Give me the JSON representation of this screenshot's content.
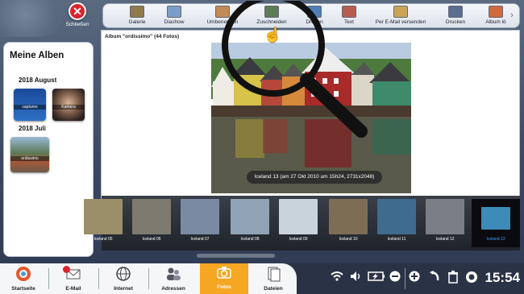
{
  "header": {
    "close_label": "Schließen"
  },
  "toolbar": {
    "items": [
      {
        "label": "Galerie",
        "icon": "gallery-icon",
        "color": "#8f7a4a"
      },
      {
        "label": "Diashow",
        "icon": "slideshow-icon",
        "color": "#7a9ec8"
      },
      {
        "label": "Umbenennen",
        "icon": "rename-icon",
        "color": "#c28a55"
      },
      {
        "label": "Zuschneiden",
        "icon": "crop-icon",
        "color": "#5b7c55"
      },
      {
        "label": "Drehen",
        "icon": "rotate-icon",
        "color": "#4f7eb5"
      },
      {
        "label": "Text",
        "icon": "text-icon",
        "color": "#b85d4d"
      },
      {
        "label": "Per E-Mail versenden",
        "icon": "email-send-icon",
        "color": "#cba45a"
      },
      {
        "label": "Drucken",
        "icon": "printer-icon",
        "color": "#5a6f8f"
      },
      {
        "label": "Album lö",
        "icon": "album-delete-icon",
        "color": "#d16a3a"
      }
    ]
  },
  "sidebar": {
    "title": "Meine Alben",
    "groups": [
      {
        "label": "2018 August",
        "albums": [
          {
            "label": "captures"
          },
          {
            "label": "Kamera"
          }
        ]
      },
      {
        "label": "2018 Juli",
        "albums": [
          {
            "label": "ordissimo"
          }
        ]
      }
    ]
  },
  "main": {
    "album_title": "Album \"ordissimo\" (44 Fotos)",
    "caption": "Iceland 13 (am 27 Okt 2010 um 15h24, 2731x2048)"
  },
  "filmstrip": [
    {
      "label": "Iceland 05",
      "color": "#9b8f6a"
    },
    {
      "label": "Iceland 06",
      "color": "#7d7a6f"
    },
    {
      "label": "Iceland 07",
      "color": "#7b8aa3"
    },
    {
      "label": "Iceland 08",
      "color": "#8fa3b5"
    },
    {
      "label": "Iceland 09",
      "color": "#c9d3dc"
    },
    {
      "label": "Iceland 10",
      "color": "#7d6d55"
    },
    {
      "label": "Iceland 11",
      "color": "#3f6b8f"
    },
    {
      "label": "Iceland 12",
      "color": "#7a7f85"
    },
    {
      "label": "Iceland 13",
      "color": "#3e8ab8"
    }
  ],
  "taskbar": {
    "items": [
      {
        "label": "Startseite",
        "icon": "home-icon"
      },
      {
        "label": "E-Mail",
        "icon": "email-icon"
      },
      {
        "label": "Internet",
        "icon": "globe-icon"
      },
      {
        "label": "Adressen",
        "icon": "contacts-icon"
      },
      {
        "label": "Fotos",
        "icon": "camera-icon"
      },
      {
        "label": "Dateien",
        "icon": "files-icon"
      }
    ],
    "active": "Fotos",
    "clock": "15:54"
  }
}
